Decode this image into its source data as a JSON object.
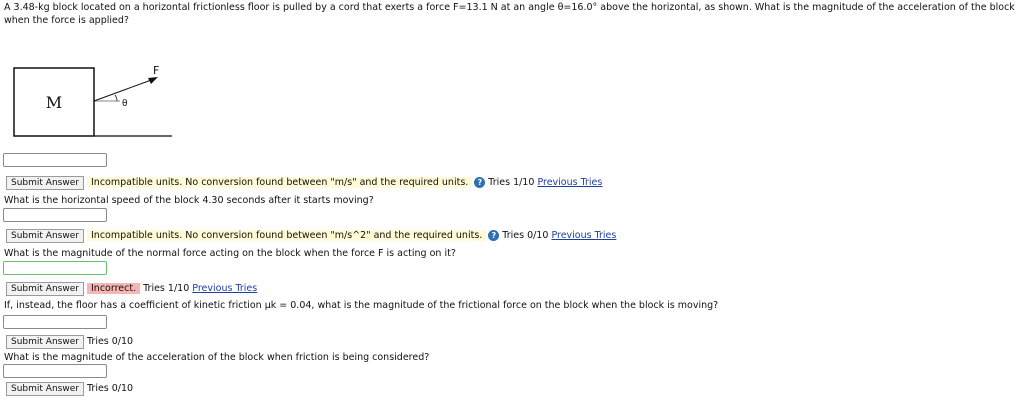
{
  "problem": {
    "text": "A 3.48-kg block located on a horizontal frictionless floor is pulled by a cord that exerts a force F=13.1 N at an angle θ=16.0° above the horizontal, as shown. What is the magnitude of the acceleration of the block when the force is applied?"
  },
  "diagram": {
    "block_label": "M",
    "force_label": "F",
    "angle_label": "θ"
  },
  "parts": [
    {
      "submit_label": "Submit Answer",
      "feedback": "Incompatible units. No conversion found between \"m/s\" and the required units.",
      "tries": "Tries 1/10",
      "previous_tries": "Previous Tries"
    },
    {
      "question": "What is the horizontal speed of the block 4.30 seconds after it starts moving?",
      "submit_label": "Submit Answer",
      "feedback": "Incompatible units. No conversion found between \"m/s^2\" and the required units.",
      "tries": "Tries 0/10",
      "previous_tries": "Previous Tries"
    },
    {
      "question": "What is the magnitude of the normal force acting on the block when the force F is acting on it?",
      "submit_label": "Submit Answer",
      "feedback": "Incorrect.",
      "tries": "Tries 1/10",
      "previous_tries": "Previous Tries"
    },
    {
      "question": "If, instead, the floor has a coefficient of kinetic friction μk = 0.04, what is the magnitude of the frictional force on the block when the block is moving?",
      "submit_label": "Submit Answer",
      "tries": "Tries 0/10"
    },
    {
      "question": "What is the magnitude of the acceleration of the block when friction is being considered?",
      "submit_label": "Submit Answer",
      "tries": "Tries 0/10"
    }
  ],
  "help_icon_glyph": "?",
  "colors": {
    "link": "#1c3fa3",
    "warning_bg": "#fffbd6",
    "error_bg": "#f7b6b6",
    "help_icon": "#2f6fb6"
  }
}
